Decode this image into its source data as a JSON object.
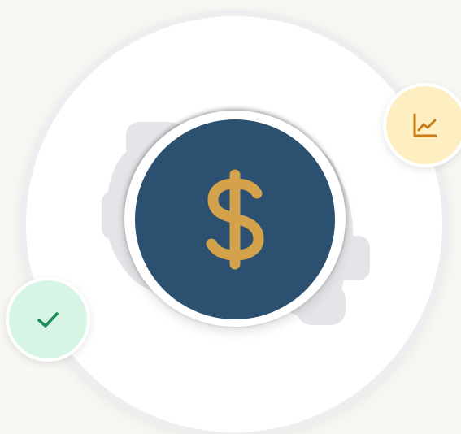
{
  "colors": {
    "background": "#f8f7f3",
    "coin_fill": "#2c5070",
    "dollar": "#d3a24a",
    "gear": "#e3e5e8",
    "chart_badge_bg": "#fdefc2",
    "chart_badge_icon": "#c97c1a",
    "check_badge_bg": "#d6f5e4",
    "check_badge_icon": "#1c8a5a"
  },
  "icons": {
    "center": "dollar-sign-icon",
    "top_right": "line-chart-icon",
    "bottom_left": "checkmark-icon",
    "background": "gear-icon"
  }
}
